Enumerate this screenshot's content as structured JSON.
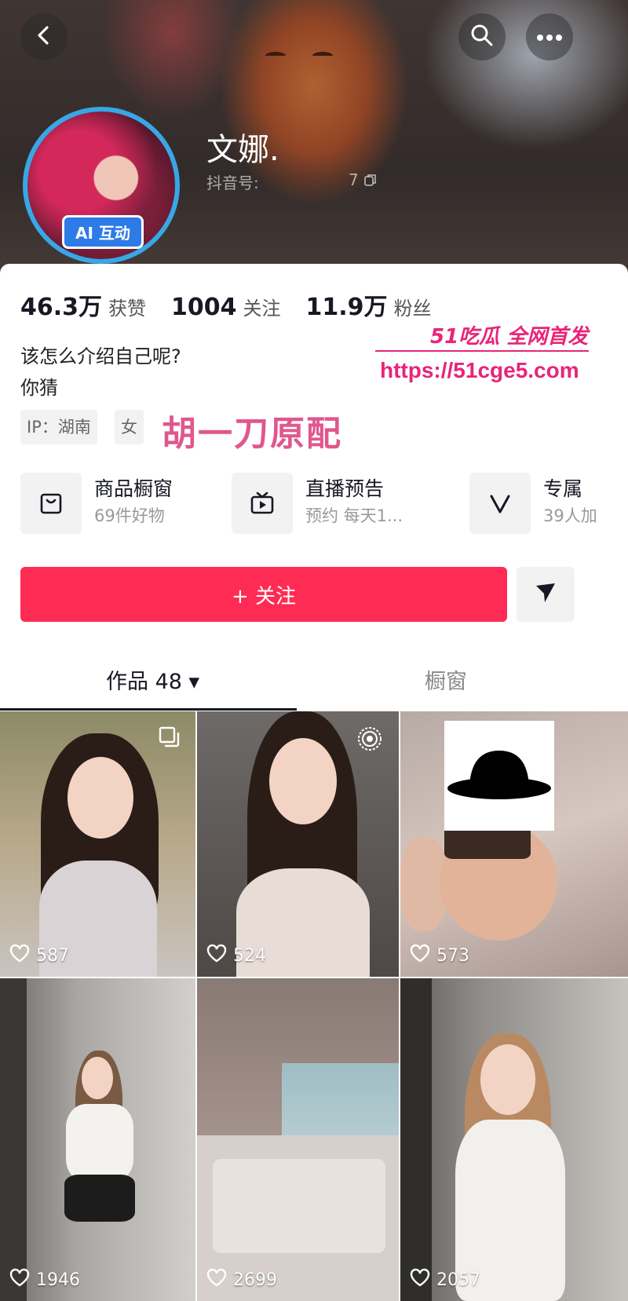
{
  "header": {
    "back_icon": "chevron-left-icon",
    "search_icon": "search-icon",
    "more_icon": "more-dots-icon",
    "nickname": "文娜.",
    "douyin_id_label": "抖音号:",
    "douyin_id_tail": "7",
    "ai_badge": "AI 互动"
  },
  "stats": [
    {
      "value": "46.3万",
      "label": "获赞"
    },
    {
      "value": "1004",
      "label": "关注"
    },
    {
      "value": "11.9万",
      "label": "粉丝"
    }
  ],
  "bio": {
    "line1": "该怎么介绍自己呢?",
    "line2": "你猜"
  },
  "tags": {
    "ip": "IP：湖南",
    "gender": "女"
  },
  "overlay_caption": "胡一刀原配",
  "watermark": {
    "title": "51吃瓜 全网首发",
    "url": "https://51cge5.com"
  },
  "features": [
    {
      "title": "商品橱窗",
      "subtitle": "69件好物",
      "icon": "shopping-bag-icon"
    },
    {
      "title": "直播预告",
      "subtitle": "预约 每天1...",
      "icon": "tv-icon"
    },
    {
      "title": "专属",
      "subtitle": "39人加",
      "icon": "v-badge-icon"
    }
  ],
  "actions": {
    "follow_label": "+ 关注",
    "share_icon": "send-arrow-icon"
  },
  "tabs": {
    "works_label": "作品 48 ▾",
    "window_label": "橱窗"
  },
  "videos": [
    {
      "likes": "587"
    },
    {
      "likes": "524"
    },
    {
      "likes": "573"
    },
    {
      "likes": "1946"
    },
    {
      "likes": "2699"
    },
    {
      "likes": "2057"
    }
  ],
  "colors": {
    "primary": "#fe2c55",
    "avatar_ring": "#37a8e6",
    "ai_badge": "#2d7be6",
    "overlay_caption": "#e0578e",
    "watermark": "#e8247a"
  }
}
